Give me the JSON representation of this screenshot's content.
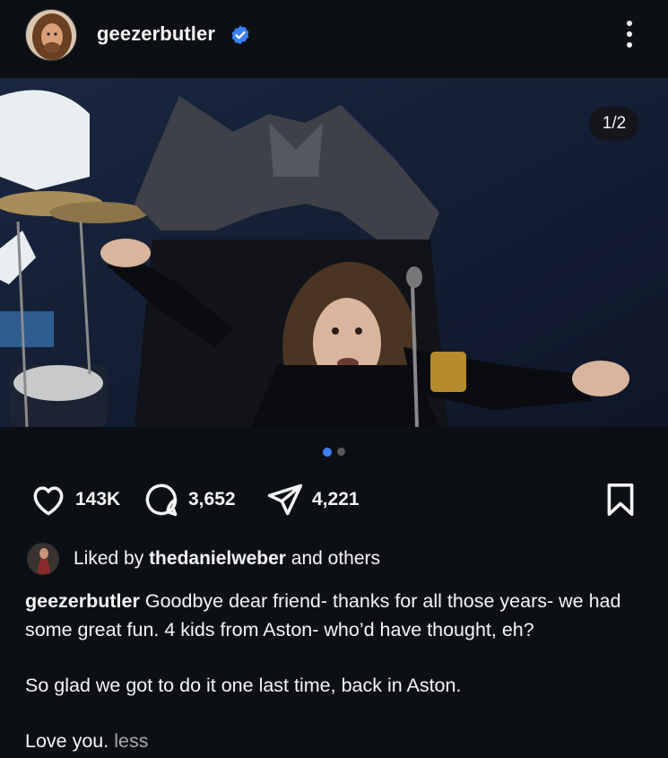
{
  "post": {
    "username": "geezerbutler",
    "verified": true,
    "carousel_counter": "1/2",
    "carousel_total": 2,
    "carousel_active": 1
  },
  "actions": {
    "likes": "143K",
    "comments": "3,652",
    "shares": "4,221"
  },
  "liked_by": {
    "prefix": "Liked by",
    "user": "thedanielweber",
    "suffix": "and others"
  },
  "caption": {
    "user": "geezerbutler",
    "line1": "Goodbye dear friend- thanks for all those years- we had some great fun. 4 kids from Aston- who’d have thought, eh?",
    "line2": "So glad we got to do it one last time, back in Aston.",
    "line3": "Love you.",
    "less_label": "less"
  },
  "colors": {
    "background": "#0c1014",
    "text": "#f5f5f5",
    "accent": "#3b82f6",
    "muted": "#a8a8a8"
  },
  "icons": {
    "verified": "verified-badge-icon",
    "more": "more-options-icon",
    "like": "heart-icon",
    "comment": "comment-bubble-icon",
    "share": "paper-plane-icon",
    "save": "bookmark-icon"
  }
}
